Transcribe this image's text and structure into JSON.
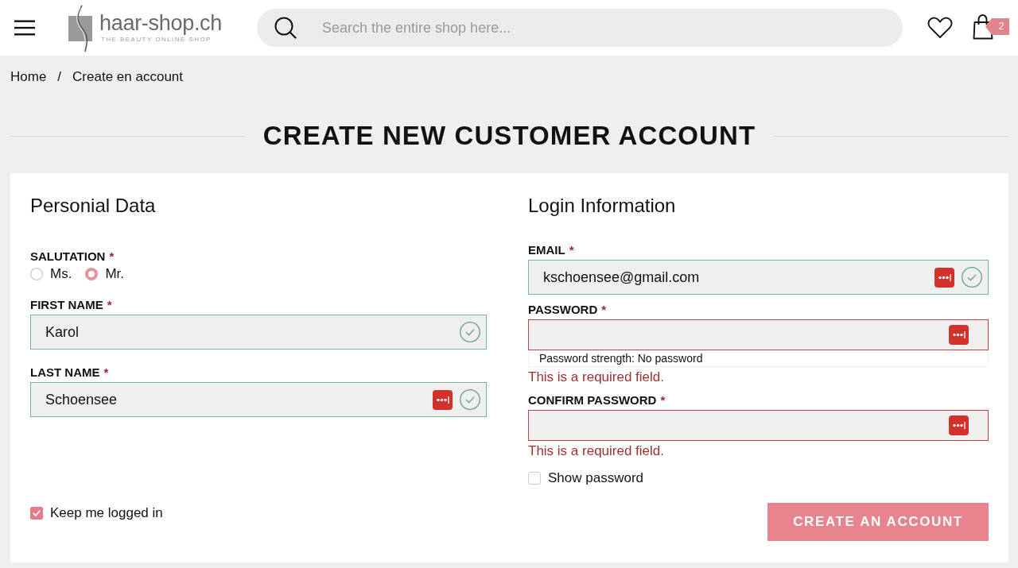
{
  "header": {
    "logo": {
      "name": "haar-shop.ch",
      "tagline": "THE BEAUTY ONLINE SHOP"
    },
    "search": {
      "placeholder": "Search the entire shop here..."
    },
    "cart_count": "2"
  },
  "breadcrumb": {
    "separator": "/",
    "items": [
      "Home",
      "Create en account"
    ]
  },
  "page_title": "CREATE NEW CUSTOMER ACCOUNT",
  "personal_data": {
    "title": "Personial Data",
    "salutation": {
      "label": "SALUTATION",
      "required_mark": "*",
      "options": [
        {
          "label": "Ms.",
          "selected": false
        },
        {
          "label": "Mr.",
          "selected": true
        }
      ]
    },
    "fields": [
      {
        "label": "FIRST NAME",
        "required_mark": "*",
        "value": "Karol",
        "valid": true,
        "password_manager": false
      },
      {
        "label": "LAST NAME",
        "required_mark": "*",
        "value": "Schoensee",
        "valid": true,
        "password_manager": true
      }
    ],
    "keep_logged_in": {
      "label": "Keep me logged in",
      "checked": true
    }
  },
  "login_information": {
    "title": "Login Information",
    "fields": [
      {
        "label": "EMAIL",
        "required_mark": "*",
        "value": "kschoensee@gmail.com",
        "valid": true,
        "password_manager": true
      },
      {
        "label": "PASSWORD",
        "required_mark": "*",
        "valid": false,
        "password_manager": true,
        "strength": "Password strength: No password",
        "error": "This is a required field."
      },
      {
        "label": "CONFIRM PASSWORD",
        "required_mark": "*",
        "valid": false,
        "password_manager": true,
        "error": "This is a required field."
      }
    ],
    "show_password": {
      "label": "Show password",
      "checked": false
    },
    "submit": "CREATE AN ACCOUNT"
  }
}
